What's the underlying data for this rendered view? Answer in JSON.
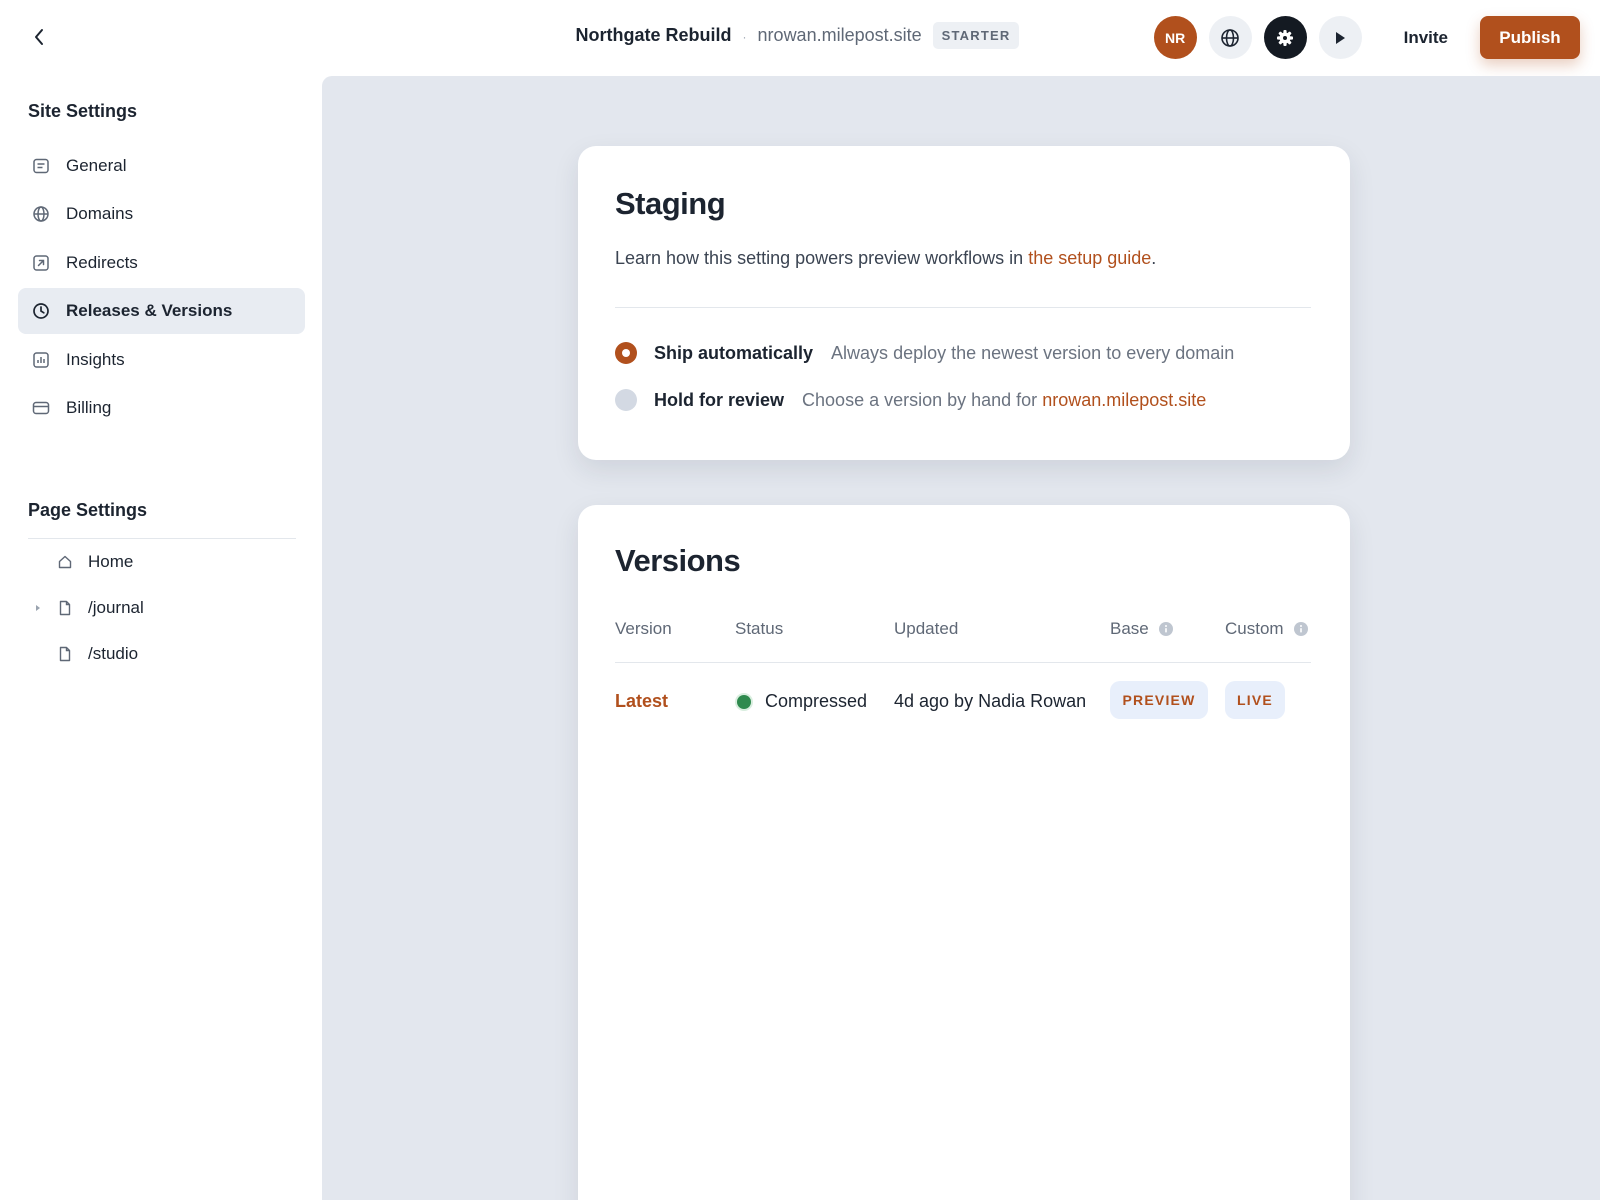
{
  "header": {
    "project_name": "Northgate Rebuild",
    "separator": "·",
    "domain": "nrowan.milepost.site",
    "plan": "STARTER",
    "avatar_initials": "NR",
    "invite_label": "Invite",
    "publish_label": "Publish"
  },
  "sidebar": {
    "site_settings_title": "Site Settings",
    "items": [
      {
        "label": "General",
        "icon": "document-lines-icon"
      },
      {
        "label": "Domains",
        "icon": "globe-icon"
      },
      {
        "label": "Redirects",
        "icon": "redirect-arrow-icon"
      },
      {
        "label": "Releases & Versions",
        "icon": "clock-icon",
        "active": true
      },
      {
        "label": "Insights",
        "icon": "bar-chart-icon"
      },
      {
        "label": "Billing",
        "icon": "credit-card-icon"
      }
    ],
    "page_settings_title": "Page Settings",
    "pages": [
      {
        "label": "Home",
        "icon": "home-icon"
      },
      {
        "label": "/journal",
        "icon": "page-icon",
        "expandable": true
      },
      {
        "label": "/studio",
        "icon": "page-icon"
      }
    ]
  },
  "staging": {
    "title": "Staging",
    "description_prefix": "Learn how this setting powers preview workflows in ",
    "description_link": "the setup guide",
    "description_suffix": ".",
    "options": [
      {
        "label": "Ship automatically",
        "description": "Always deploy the newest version to every domain",
        "selected": true
      },
      {
        "label": "Hold for review",
        "description_prefix": "Choose a version by hand for ",
        "description_link": "nrowan.milepost.site",
        "selected": false
      }
    ]
  },
  "versions": {
    "title": "Versions",
    "columns": {
      "version": "Version",
      "status": "Status",
      "updated": "Updated",
      "base": "Base",
      "custom": "Custom"
    },
    "rows": [
      {
        "version": "Latest",
        "status": "Compressed",
        "updated": "4d ago by Nadia Rowan",
        "base": "PREVIEW",
        "custom": "LIVE"
      }
    ]
  },
  "colors": {
    "accent": "#b1501d",
    "status_ok": "#2f8a4e",
    "main_bg": "#e3e7ee"
  }
}
